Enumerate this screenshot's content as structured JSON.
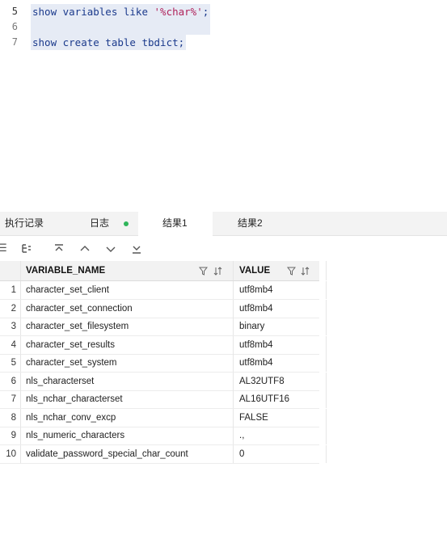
{
  "editor": {
    "lines": [
      {
        "num": "5",
        "before": "show variables like ",
        "string": "'%char%'",
        "after": ";"
      },
      {
        "num": "6",
        "text": ""
      },
      {
        "num": "7",
        "text": "show create table tbdict;"
      }
    ]
  },
  "tabs": [
    {
      "label": "执行记录"
    },
    {
      "label": "日志"
    },
    {
      "label": "结果1"
    },
    {
      "label": "结果2"
    }
  ],
  "toolbar": {
    "icons": [
      "list-icon",
      "tree-icon",
      "first-icon",
      "up-icon",
      "down-icon",
      "last-icon"
    ]
  },
  "grid": {
    "columns": [
      {
        "label": "VARIABLE_NAME"
      },
      {
        "label": "VALUE"
      }
    ],
    "rows": [
      {
        "idx": "1",
        "name": "character_set_client",
        "value": "utf8mb4"
      },
      {
        "idx": "2",
        "name": "character_set_connection",
        "value": "utf8mb4"
      },
      {
        "idx": "3",
        "name": "character_set_filesystem",
        "value": "binary"
      },
      {
        "idx": "4",
        "name": "character_set_results",
        "value": "utf8mb4"
      },
      {
        "idx": "5",
        "name": "character_set_system",
        "value": "utf8mb4"
      },
      {
        "idx": "6",
        "name": "nls_characterset",
        "value": "AL32UTF8"
      },
      {
        "idx": "7",
        "name": "nls_nchar_characterset",
        "value": "AL16UTF16"
      },
      {
        "idx": "8",
        "name": "nls_nchar_conv_excp",
        "value": "FALSE"
      },
      {
        "idx": "9",
        "name": "nls_numeric_characters",
        "value": ".,"
      },
      {
        "idx": "10",
        "name": "validate_password_special_char_count",
        "value": "0"
      }
    ]
  },
  "colors": {
    "accent": "#2fb55a",
    "code": "#1b3a8c",
    "string": "#b0225a",
    "selection": "#e6ebf5"
  }
}
